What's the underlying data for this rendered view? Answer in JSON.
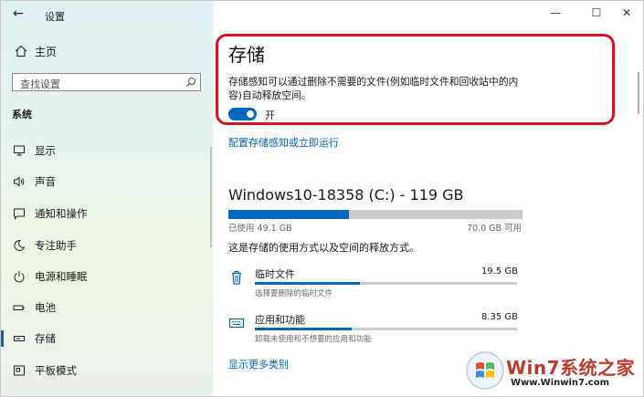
{
  "window": {
    "title": "设置",
    "controls": {
      "minimize": "—",
      "maximize": "☐",
      "close": "✕"
    }
  },
  "sidebar": {
    "home": "主页",
    "search_placeholder": "查找设置",
    "section": "系统",
    "items": [
      {
        "label": "显示",
        "icon": "display-icon"
      },
      {
        "label": "声音",
        "icon": "sound-icon"
      },
      {
        "label": "通知和操作",
        "icon": "notification-icon"
      },
      {
        "label": "专注助手",
        "icon": "moon-icon"
      },
      {
        "label": "电源和睡眠",
        "icon": "power-icon"
      },
      {
        "label": "电池",
        "icon": "battery-icon"
      },
      {
        "label": "存储",
        "icon": "storage-icon",
        "active": true
      },
      {
        "label": "平板模式",
        "icon": "tablet-icon"
      }
    ]
  },
  "main": {
    "title": "存储",
    "description": "存储感知可以通过删除不需要的文件(例如临时文件和回收站中的内容)自动释放空间。",
    "toggle_label": "开",
    "toggle_on": true,
    "config_link": "配置存储感知或立即运行",
    "drive": {
      "title": "Windows10-18358 (C:) - 119 GB",
      "used": "已使用 49.1 GB",
      "free": "70.0 GB 可用",
      "used_fraction": 0.41
    },
    "usage_note": "这是存储的使用方式以及空间的释放方式。",
    "categories": [
      {
        "name": "临时文件",
        "size": "19.5 GB",
        "sub": "选择要删除的临时文件",
        "fraction": 0.4,
        "icon": "trash-icon"
      },
      {
        "name": "应用和功能",
        "size": "8.35 GB",
        "sub": "卸载未使用和不想要的应用和功能",
        "fraction": 0.37,
        "icon": "keyboard-icon"
      }
    ],
    "more_link": "显示更多类别"
  },
  "watermark": {
    "brand": "Win7系统之家",
    "url": "Www.Winwin7.com"
  },
  "colors": {
    "accent": "#0067c0",
    "highlight": "#d6141f"
  }
}
